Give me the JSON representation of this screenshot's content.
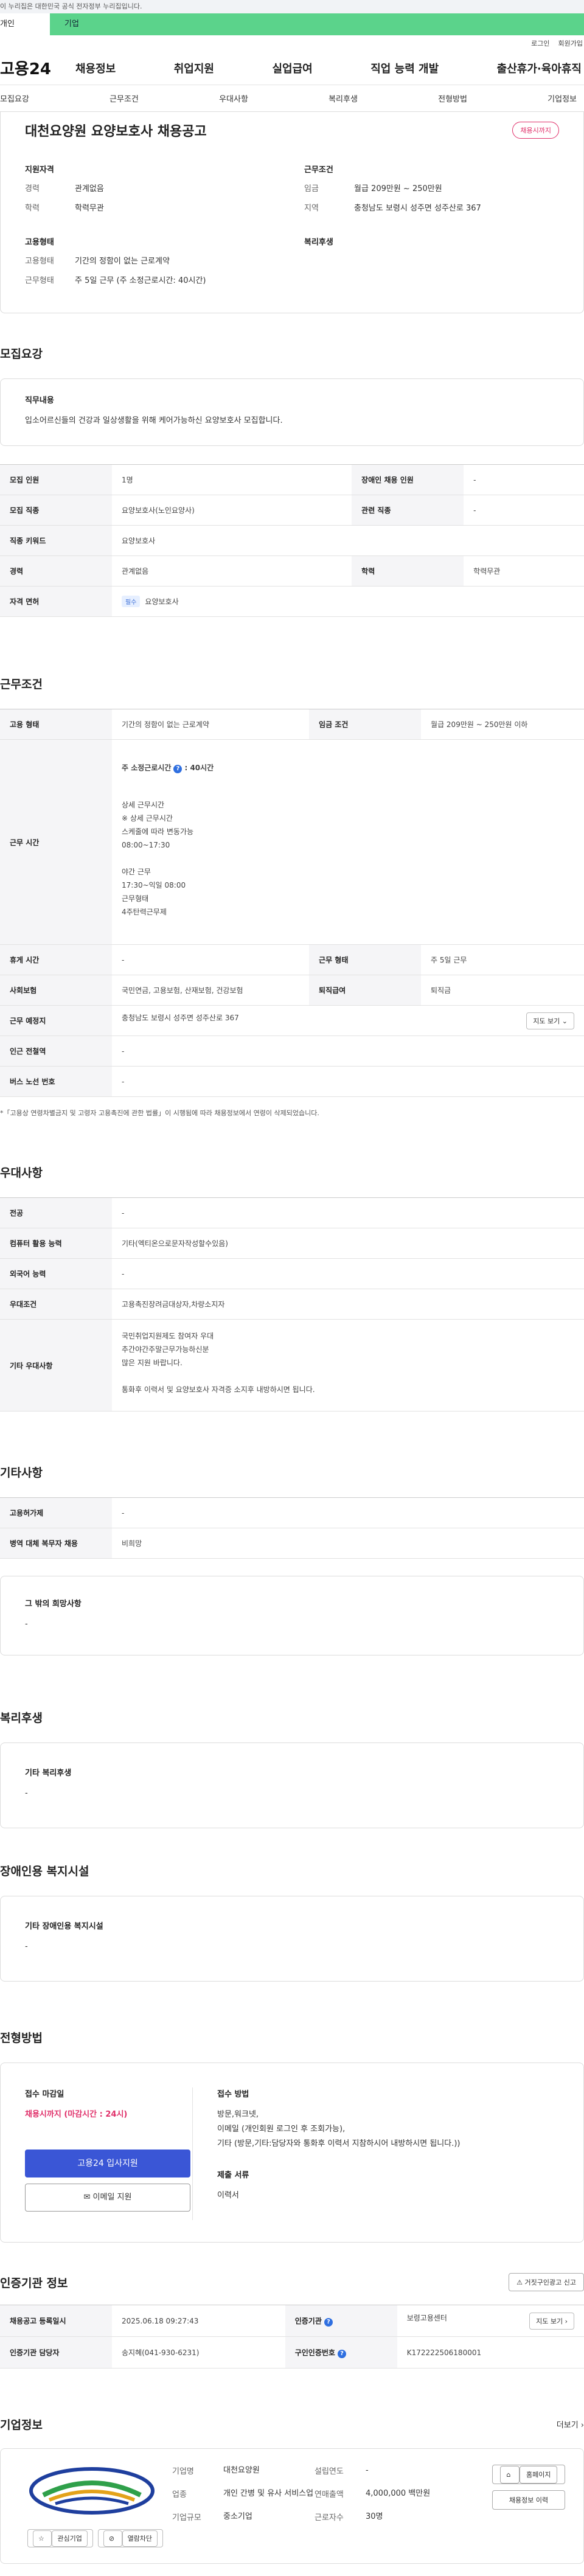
{
  "gov_banner": "이 누리집은 대한민국 공식 전자정부 누리집입니다.",
  "tabs": {
    "individual": "개인",
    "business": "기업"
  },
  "util": {
    "login": "로그인",
    "signup": "회원가입"
  },
  "brand": {
    "logo": "고용24",
    "accent": "#5bd38b"
  },
  "gnb": [
    "채용정보",
    "취업지원",
    "실업급여",
    "직업 능력 개발",
    "출산휴가·육아휴직"
  ],
  "anchor_tabs": [
    "모집요강",
    "근무조건",
    "우대사항",
    "복리후생",
    "전형방법",
    "기업정보"
  ],
  "summary": {
    "title": "대천요양원 요양보호사 채용공고",
    "badge": "채용시까지",
    "qual_title": "지원자격",
    "qual": [
      {
        "k": "경력",
        "v": "관계없음"
      },
      {
        "k": "학력",
        "v": "학력무관"
      }
    ],
    "cond_title": "근무조건",
    "cond": [
      {
        "k": "임금",
        "v": "월급 209만원 ~ 250만원"
      },
      {
        "k": "지역",
        "v": "충청남도 보령시 성주면 성주산로 367"
      }
    ],
    "emp_title": "고용형태",
    "emp": [
      {
        "k": "고용형태",
        "v": "기간의 정함이 없는 근로계약"
      },
      {
        "k": "근무형태",
        "v": "주 5일 근무 (주 소정근로시간: 40시간)"
      }
    ],
    "welfare_title": "복리후생"
  },
  "recruit": {
    "title": "모집요강",
    "duty_title": "직무내용",
    "duty": "입소어르신들의 건강과 일상생활을 위해 케어가능하신 요양보호사 모집합니다.",
    "rows": [
      {
        "k1": "모집 인원",
        "v1": "1명",
        "k2": "장애인 채용 인원",
        "v2": "-"
      },
      {
        "k1": "모집 직종",
        "v1": "요양보호사(노인요양사)",
        "k2": "관련 직종",
        "v2": "-"
      },
      {
        "k1": "직종 키워드",
        "v1": "요양보호사"
      },
      {
        "k1": "경력",
        "v1": "관계없음",
        "k2": "학력",
        "v2": "학력무관"
      },
      {
        "k1": "자격 면허",
        "pill": "필수",
        "v1": "요양보호사"
      }
    ]
  },
  "work": {
    "title": "근무조건",
    "emp_k": "고용 형태",
    "emp_v": "기간의 정함이 없는 근로계약",
    "wage_k": "임금 조건",
    "wage_v": "월급 209만원 ~ 250만원 이하",
    "hours_k": "근무 시간",
    "hours_head": "주 소정근로시간",
    "hours_value": ": 40시간",
    "hours_detail": "상세 근무시간\n※ 상세 근무시간\n  스케줄에 따라 변동가능\n08:00~17:30\n\n야간 근무\n17:30~익일 08:00\n근무형태\n4주탄력근무제",
    "break_k": "휴게 시간",
    "break_v": "-",
    "type_k": "근무 형태",
    "type_v": "주 5일 근무",
    "ins_k": "사회보험",
    "ins_v": "국민연금, 고용보험, 산재보험, 건강보험",
    "sev_k": "퇴직급여",
    "sev_v": "퇴직금",
    "place_k": "근무 예정지",
    "place_v": "충청남도 보령시 성주면 성주산로 367",
    "map_btn": "지도 보기 ⌄",
    "station_k": "인근 전철역",
    "station_v": "-",
    "bus_k": "버스 노선 번호",
    "bus_v": "-",
    "note": "*「고용상 연령차별금지 및 고령자 고용촉진에 관한 법률」이 시행됨에 따라 채용정보에서 연령이 삭제되었습니다."
  },
  "pref": {
    "title": "우대사항",
    "rows": [
      {
        "k": "전공",
        "v": "-"
      },
      {
        "k": "컴퓨터 활용 능력",
        "v": "기타(엑티온으로문자작성할수있음)"
      },
      {
        "k": "외국어 능력",
        "v": "-"
      },
      {
        "k": "우대조건",
        "v": "고용촉진장려금대상자,차량소지자"
      },
      {
        "k": "기타 우대사항",
        "v": "국민취업지원제도 참여자 우대\n추간야간주말근무가능하신분\n많은 지원 바랍니다.\n\n통화후 이력서 및 요양보호사 자격증 소지후 내방하시면 됩니다."
      }
    ]
  },
  "etc": {
    "title": "기타사항",
    "rows": [
      {
        "k": "고용허가제",
        "v": "-"
      },
      {
        "k": "병역 대체 복무자 채용",
        "v": "비희망"
      }
    ],
    "other_title": "그 밖의 희망사항",
    "other_v": "-"
  },
  "welfare": {
    "title": "복리후생",
    "sub": "기타 복리후생",
    "v": "-"
  },
  "disabled": {
    "title": "장애인용 복지시설",
    "sub": "기타 장애인용 복지시설",
    "v": "-"
  },
  "screening": {
    "title": "전형방법",
    "deadline_title": "접수 마감일",
    "deadline": "채용시까지 (마감시간 : 24시)",
    "apply_btn": "고용24 입사지원",
    "email_btn": "이메일 지원",
    "method_title": "접수 방법",
    "method": "방문,워크넷,\n이메일 (개인회원 로그인 후 조회가능),\n기타 (방문,기타:담당자와 통화후 이력서 지참하시어 내방하시면 됩니다.))",
    "docs_title": "제출 서류",
    "docs": "이력서"
  },
  "cert": {
    "title": "인증기관 정보",
    "report": "거짓구인광고 신고",
    "reg_k": "채용공고 등록일시",
    "reg_v": "2025.06.18 09:27:43",
    "org_k": "인증기관",
    "org_v": "보령고용센터",
    "map_btn": "지도 보기 ›",
    "mgr_k": "인증기관 담당자",
    "mgr_v": "송지혜(041-930-6231)",
    "num_k": "구인인증번호",
    "num_v": "K172222506180001"
  },
  "company": {
    "title": "기업정보",
    "more": "더보기 ›",
    "fav": "관심기업",
    "block": "열람차단",
    "home": "홈페이지",
    "list": "채용정보 이력",
    "fields": [
      {
        "k": "기업명",
        "v": "대천요양원"
      },
      {
        "k": "설립연도",
        "v": "-"
      },
      {
        "k": "업종",
        "v": "개인 간병 및 유사 서비스업"
      },
      {
        "k": "연매출액",
        "v": "4,000,000 백만원"
      },
      {
        "k": "기업규모",
        "v": "중소기업"
      },
      {
        "k": "근로자수",
        "v": "30명"
      }
    ]
  }
}
